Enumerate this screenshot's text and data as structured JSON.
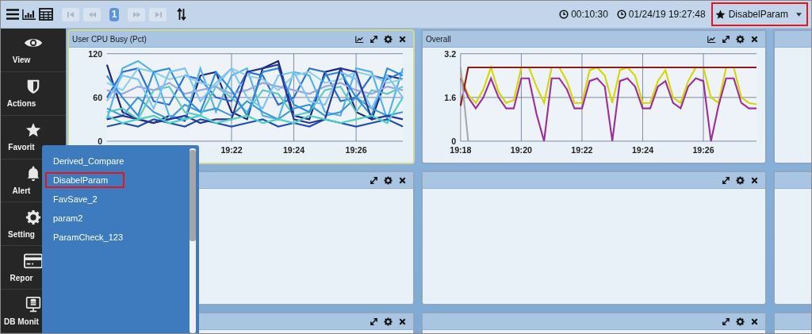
{
  "toolbar": {
    "left_tools": [
      {
        "kind": "menu"
      },
      {
        "kind": "bar-chart"
      },
      {
        "kind": "table"
      }
    ],
    "pager": [
      {
        "kind": "first",
        "disabled": true
      },
      {
        "kind": "prev",
        "disabled": true
      },
      {
        "kind": "page",
        "label": "1"
      },
      {
        "kind": "next",
        "disabled": true
      },
      {
        "kind": "last",
        "disabled": true
      }
    ],
    "right_tools": [
      {
        "kind": "sort"
      }
    ],
    "elapsed": "00:10:30",
    "timestamp": "01/24/19 19:27:48",
    "favorite": {
      "label": "DisabelParam",
      "highlighted": true
    }
  },
  "sidebar": {
    "items": [
      {
        "kind": "eye",
        "label": "View"
      },
      {
        "kind": "shield",
        "label": "Actions"
      },
      {
        "kind": "star",
        "label": "Favorit"
      },
      {
        "kind": "bell",
        "label": "Alert"
      },
      {
        "kind": "gear",
        "label": "Setting"
      },
      {
        "kind": "card",
        "label": "Repor"
      },
      {
        "kind": "monitor",
        "label": "DB Monit"
      }
    ]
  },
  "favorites_menu": {
    "items": [
      {
        "label": "Derived_Compare",
        "highlighted": false
      },
      {
        "label": "DisabelParam",
        "highlighted": true
      },
      {
        "label": "FavSave_2",
        "highlighted": false
      },
      {
        "label": "param2",
        "highlighted": false
      },
      {
        "label": "ParamCheck_123",
        "highlighted": false
      }
    ]
  },
  "panels": [
    {
      "title": "User CPU Busy (Pct)",
      "focused": true,
      "icons": [
        {
          "kind": "chart"
        },
        {
          "kind": "expand"
        },
        {
          "kind": "settings"
        },
        {
          "kind": "close"
        }
      ],
      "chart_data": {
        "type": "line",
        "categories": [
          null,
          null,
          null,
          null,
          null,
          null,
          null,
          null,
          "19:22",
          null,
          null,
          null,
          "19:24",
          null,
          null,
          null,
          "19:26",
          null,
          null,
          null
        ],
        "ylim": [
          0,
          120
        ],
        "yticks": [
          0,
          60,
          120
        ],
        "grid": true,
        "series": [
          {
            "color": "#1a237e",
            "values": [
              105,
              40,
              30,
              25,
              35,
              28,
              90,
              95,
              40,
              30,
              100,
              110,
              35,
              30,
              95,
              100,
              40,
              30,
              90,
              85
            ]
          },
          {
            "color": "#2b6fd6",
            "values": [
              60,
              95,
              100,
              55,
              50,
              90,
              85,
              60,
              55,
              95,
              90,
              50,
              60,
              100,
              95,
              55,
              60,
              90,
              85,
              95
            ]
          },
          {
            "color": "#55b0f0",
            "values": [
              30,
              100,
              110,
              95,
              35,
              30,
              100,
              40,
              90,
              100,
              35,
              30,
              95,
              90,
              40,
              35,
              100,
              95,
              30,
              100
            ]
          },
          {
            "color": "#8fd0e8",
            "values": [
              80,
              70,
              100,
              95,
              85,
              90,
              80,
              75,
              100,
              90,
              85,
              70,
              90,
              95,
              80,
              85,
              95,
              90,
              80,
              85
            ]
          },
          {
            "color": "#3a9ad9",
            "values": [
              45,
              35,
              60,
              40,
              30,
              50,
              40,
              45,
              35,
              55,
              40,
              30,
              45,
              50,
              35,
              40,
              60,
              45,
              35,
              40
            ]
          },
          {
            "color": "#5fc8c0",
            "values": [
              40,
              45,
              30,
              70,
              75,
              40,
              35,
              75,
              60,
              40,
              70,
              65,
              35,
              40,
              70,
              75,
              40,
              70,
              65,
              75
            ]
          },
          {
            "color": "#1f4fb5",
            "values": [
              20,
              25,
              20,
              30,
              25,
              20,
              30,
              25,
              20,
              25,
              30,
              20,
              25,
              20,
              30,
              25,
              20,
              25,
              30,
              20
            ]
          },
          {
            "color": "#9aa8e0",
            "values": [
              70,
              65,
              75,
              70,
              80,
              65,
              70,
              75,
              65,
              70,
              80,
              75,
              70,
              65,
              75,
              80,
              70,
              65,
              75,
              70
            ]
          },
          {
            "color": "#2d8ce0",
            "values": [
              90,
              60,
              35,
              95,
              100,
              60,
              40,
              95,
              70,
              35,
              95,
              100,
              50,
              40,
              90,
              95,
              60,
              35,
              100,
              90
            ]
          },
          {
            "color": "#7ec3f5",
            "values": [
              55,
              90,
              85,
              45,
              95,
              100,
              55,
              80,
              100,
              60,
              45,
              90,
              95,
              55,
              50,
              95,
              85,
              45,
              90,
              60
            ]
          },
          {
            "color": "#283593",
            "values": [
              30,
              35,
              30,
              25,
              30,
              35,
              25,
              30,
              30,
              95,
              100,
              105,
              30,
              25,
              30,
              100,
              95,
              30,
              35,
              30
            ]
          },
          {
            "color": "#4dd0c4",
            "values": [
              35,
              25,
              30,
              35,
              25,
              30,
              35,
              25,
              30,
              35,
              25,
              30,
              25,
              35,
              30,
              25,
              30,
              35,
              25,
              60
            ]
          }
        ]
      }
    },
    {
      "title": "Overall",
      "focused": false,
      "icons": [
        {
          "kind": "chart"
        },
        {
          "kind": "expand"
        },
        {
          "kind": "settings"
        },
        {
          "kind": "close"
        }
      ],
      "chart_data": {
        "type": "line",
        "categories": [
          "19:18",
          null,
          null,
          null,
          null,
          null,
          null,
          null,
          "19:20",
          null,
          null,
          null,
          null,
          null,
          null,
          null,
          "19:22",
          null,
          null,
          null,
          null,
          null,
          null,
          null,
          "19:24",
          null,
          null,
          null,
          null,
          null,
          null,
          null,
          "19:26",
          null,
          null,
          null,
          null,
          null,
          null,
          null
        ],
        "ylim": [
          0,
          3.2
        ],
        "yticks": [
          0,
          1.6,
          3.2
        ],
        "grid": true,
        "series": [
          {
            "color": "#d6d600",
            "values": [
              2.4,
              1.7,
              1.4,
              1.9,
              2.7,
              1.8,
              1.4,
              1.5,
              2.7,
              2.7,
              2.0,
              1.4,
              2.7,
              2.7,
              2.2,
              1.4,
              1.4,
              2.6,
              2.7,
              2.4,
              1.4,
              2.6,
              2.7,
              2.4,
              1.4,
              1.4,
              2.2,
              2.6,
              1.6,
              1.4,
              2.2,
              2.7,
              2.7,
              1.6,
              1.4,
              2.7,
              2.7,
              1.6,
              1.4,
              1.35
            ]
          },
          {
            "color": "#9b2f9b",
            "values": [
              2.3,
              1.6,
              1.2,
              1.6,
              2.3,
              1.6,
              1.2,
              1.2,
              2.3,
              2.3,
              1.0,
              0,
              2.3,
              2.3,
              1.9,
              1.2,
              1.2,
              2.2,
              2.3,
              2.0,
              0,
              2.2,
              2.3,
              2.0,
              1.2,
              1.2,
              2.0,
              2.2,
              1.4,
              1.2,
              2.0,
              2.3,
              2.2,
              0,
              1.3,
              2.3,
              2.3,
              1.4,
              1.2,
              1.2
            ]
          },
          {
            "color": "#8b1c1c",
            "values": [
              1.3,
              2.7,
              2.7,
              2.7,
              2.7,
              2.7,
              2.7,
              2.7,
              2.7,
              2.7,
              2.7,
              2.7,
              2.7,
              2.7,
              2.7,
              2.7,
              2.7,
              2.7,
              2.7,
              2.7,
              2.7,
              2.7,
              2.7,
              2.7,
              2.7,
              2.7,
              2.7,
              2.7,
              2.7,
              2.7,
              2.7,
              2.7,
              2.7,
              2.7,
              2.7,
              2.7,
              2.7,
              2.7,
              2.7,
              2.7
            ]
          },
          {
            "color": "#a8a8a8",
            "values": [
              2.7,
              0,
              null,
              null,
              null,
              null,
              null,
              null,
              null,
              null,
              null,
              null,
              null,
              null,
              null,
              null,
              null,
              null,
              null,
              null,
              null,
              null,
              null,
              null,
              null,
              null,
              null,
              null,
              null,
              null,
              null,
              null,
              null,
              null,
              null,
              null,
              null,
              null,
              null,
              null
            ]
          }
        ]
      }
    },
    {
      "focused": false
    },
    {
      "focused": false,
      "icons": [
        {
          "kind": "expand"
        },
        {
          "kind": "settings"
        },
        {
          "kind": "close"
        }
      ]
    },
    {
      "focused": false,
      "icons": [
        {
          "kind": "expand"
        },
        {
          "kind": "settings"
        },
        {
          "kind": "close"
        }
      ]
    },
    {
      "focused": false
    },
    {
      "focused": false,
      "icons": [
        {
          "kind": "expand"
        },
        {
          "kind": "settings"
        },
        {
          "kind": "close"
        }
      ]
    },
    {
      "focused": false,
      "icons": [
        {
          "kind": "expand"
        },
        {
          "kind": "settings"
        },
        {
          "kind": "close"
        }
      ]
    },
    {
      "focused": false
    }
  ]
}
